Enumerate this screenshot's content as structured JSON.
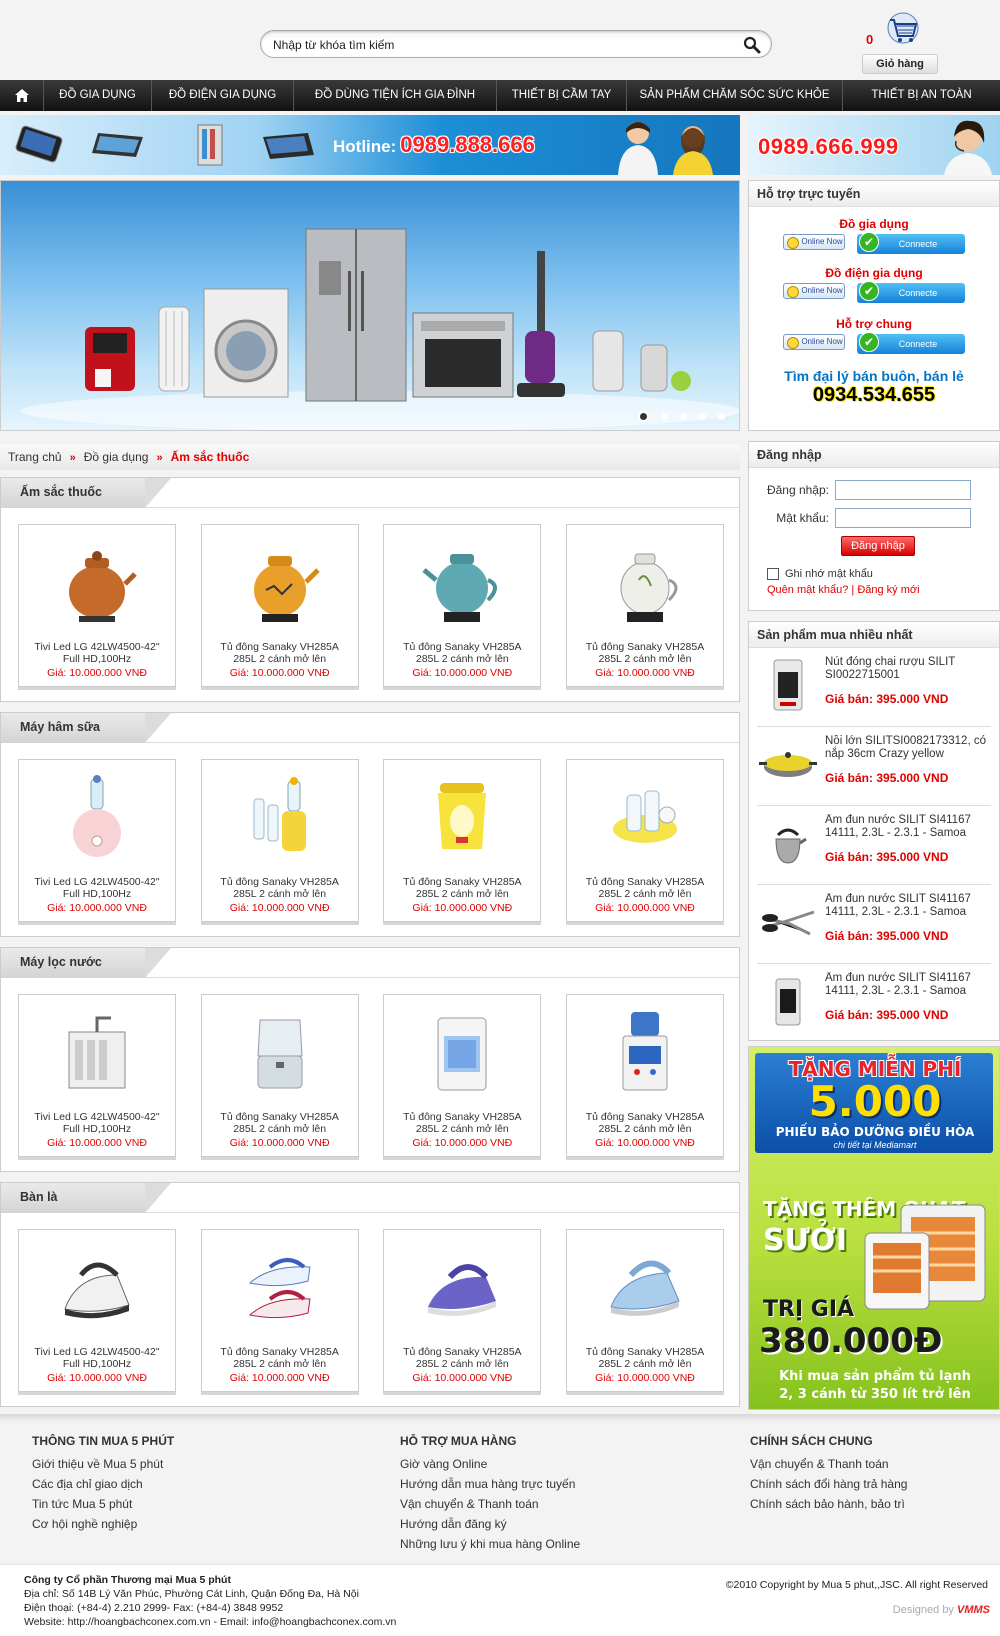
{
  "header": {
    "search_placeholder": "Nhập từ khóa tìm kiếm",
    "cart_count": "0",
    "cart_label": "Giỏ hàng"
  },
  "nav": {
    "items": [
      {
        "label": "ĐỒ GIA DỤNG"
      },
      {
        "label": "ĐỒ ĐIỆN GIA DỤNG"
      },
      {
        "label": "ĐỒ DÙNG TIỆN ÍCH GIA ĐÌNH"
      },
      {
        "label": "THIẾT BỊ CẦM TAY"
      },
      {
        "label": "SẢN PHẨM CHĂM SÓC SỨC KHỎE"
      },
      {
        "label": "THIẾT BỊ AN TOÀN"
      }
    ]
  },
  "banner": {
    "hotline_label": "Hotline:",
    "hotline_number": "0989.888.666",
    "support_number": "0989.666.999"
  },
  "support": {
    "title": "Hỗ trợ trực tuyến",
    "groups": [
      {
        "label": "Đồ gia dụng"
      },
      {
        "label": "Đồ điện gia dụng"
      },
      {
        "label": "Hỗ trợ chung"
      }
    ],
    "online_label": "Online Now",
    "connect_label": "Connecte",
    "dealer_text": "Tìm đại lý bán buôn, bán lẻ",
    "dealer_phone": "0934.534.655"
  },
  "breadcrumb": {
    "home": "Trang chủ",
    "category": "Đồ gia dụng",
    "current": "Ấm sắc thuốc",
    "separator": "»"
  },
  "sections": [
    {
      "title": "Ấm sắc thuốc",
      "products": [
        {
          "name": "Tivi Led LG 42LW4500-42\" Full HD,100Hz",
          "price": "Giá: 10.000.000 VNĐ"
        },
        {
          "name": "Tủ đông Sanaky VH285A 285L 2 cánh mở lên",
          "price": "Giá: 10.000.000 VNĐ"
        },
        {
          "name": "Tủ đông Sanaky VH285A 285L 2 cánh mở lên",
          "price": "Giá: 10.000.000 VNĐ"
        },
        {
          "name": "Tủ đông Sanaky VH285A 285L 2 cánh mở lên",
          "price": "Giá: 10.000.000 VNĐ"
        }
      ]
    },
    {
      "title": "Máy hâm sữa",
      "products": [
        {
          "name": "Tivi Led LG 42LW4500-42\" Full HD,100Hz",
          "price": "Giá: 10.000.000 VNĐ"
        },
        {
          "name": "Tủ đông Sanaky VH285A 285L 2 cánh mở lên",
          "price": "Giá: 10.000.000 VNĐ"
        },
        {
          "name": "Tủ đông Sanaky VH285A 285L 2 cánh mở lên",
          "price": "Giá: 10.000.000 VNĐ"
        },
        {
          "name": "Tủ đông Sanaky VH285A 285L 2 cánh mở lên",
          "price": "Giá: 10.000.000 VNĐ"
        }
      ]
    },
    {
      "title": "Máy lọc nước",
      "products": [
        {
          "name": "Tivi Led LG 42LW4500-42\" Full HD,100Hz",
          "price": "Giá: 10.000.000 VNĐ"
        },
        {
          "name": "Tủ đông Sanaky VH285A 285L 2 cánh mở lên",
          "price": "Giá: 10.000.000 VNĐ"
        },
        {
          "name": "Tủ đông Sanaky VH285A 285L 2 cánh mở lên",
          "price": "Giá: 10.000.000 VNĐ"
        },
        {
          "name": "Tủ đông Sanaky VH285A 285L 2 cánh mở lên",
          "price": "Giá: 10.000.000 VNĐ"
        }
      ]
    },
    {
      "title": "Bàn là",
      "products": [
        {
          "name": "Tivi Led LG 42LW4500-42\" Full HD,100Hz",
          "price": "Giá: 10.000.000 VNĐ"
        },
        {
          "name": "Tủ đông Sanaky VH285A 285L 2 cánh mở lên",
          "price": "Giá: 10.000.000 VNĐ"
        },
        {
          "name": "Tủ đông Sanaky VH285A 285L 2 cánh mở lên",
          "price": "Giá: 10.000.000 VNĐ"
        },
        {
          "name": "Tủ đông Sanaky VH285A 285L 2 cánh mở lên",
          "price": "Giá: 10.000.000 VNĐ"
        }
      ]
    }
  ],
  "login": {
    "title": "Đăng nhập",
    "username_label": "Đăng nhập:",
    "password_label": "Mật khẩu:",
    "submit_label": "Đăng nhập",
    "remember_label": "Ghi nhớ mật khẩu",
    "forgot_label": "Quên mật khẩu?",
    "divider": "|",
    "register_label": "Đăng ký mới"
  },
  "bestsellers": {
    "title": "Sản phẩm mua nhiều nhất",
    "items": [
      {
        "name": "Nút đóng chai rượu SILIT SI0022715001",
        "price": "Giá bán: 395.000 VND"
      },
      {
        "name": "Nồi lớn SILITSI0082173312, có nắp 36cm Crazy yellow",
        "price": "Giá bán: 395.000 VND"
      },
      {
        "name": "Ấm đun nước SILIT SI41167 14111, 2.3L - 2.3.1 - Samoa",
        "price": "Giá bán: 395.000 VND"
      },
      {
        "name": "Ấm đun nước SILIT SI41167 14111, 2.3L - 2.3.1 - Samoa",
        "price": "Giá bán: 395.000 VND"
      },
      {
        "name": "Ấm đun nước SILIT SI41167 14111, 2.3L - 2.3.1 - Samoa",
        "price": "Giá bán: 395.000 VND"
      }
    ]
  },
  "promo": {
    "line1": "TẶNG MIỄN PHÍ",
    "line2": "5.000",
    "line3": "PHIẾU BẢO DƯỠNG ĐIỀU HÒA",
    "line4": "chi tiết tại Mediamart",
    "line5": "TẶNG THÊM QUẠT",
    "line6": "SƯỞI",
    "line7": "TRỊ GIÁ",
    "line8": "380.000Đ",
    "line9": "Khi mua sản phẩm tủ lạnh",
    "line10": "2, 3 cánh từ 350 lít trở lên"
  },
  "footer": {
    "columns": [
      {
        "title": "THÔNG TIN MUA 5 PHÚT",
        "links": [
          "Giới thiệu về Mua 5 phút",
          "Các địa chỉ giao dịch",
          "Tin tức Mua 5 phút",
          "Cơ hội nghề nghiệp"
        ]
      },
      {
        "title": "HỖ TRỢ MUA HÀNG",
        "links": [
          "Giờ vàng Online",
          "Hướng dẫn mua hàng trực tuyến",
          "Vận chuyển & Thanh toán",
          "Hướng dẫn đăng ký",
          "Những lưu ý khi mua hàng Online"
        ]
      },
      {
        "title": "CHÍNH SÁCH CHUNG",
        "links": [
          "Vận chuyển & Thanh toán",
          "Chính sách đổi hàng trả hàng",
          "Chính sách bảo hành, bảo trì"
        ]
      }
    ],
    "company_name": "Công ty Cổ phần Thương mại Mua 5 phút",
    "address": "Địa chỉ: Số 14B Lý Văn Phúc, Phường Cát Linh, Quận Đống Đa, Hà Nội",
    "phone": "Điện thoại: (+84-4) 2.210 2999- Fax: (+84-4) 3848 9952",
    "website": "Website: http://hoangbachconex.com.vn - Email: info@hoangbachconex.com.vn",
    "copyright": "©2010 Copyright by Mua 5 phut,,JSC. All right Reserved",
    "designed_by": "Designed by",
    "designer_logo": "VMMS"
  }
}
